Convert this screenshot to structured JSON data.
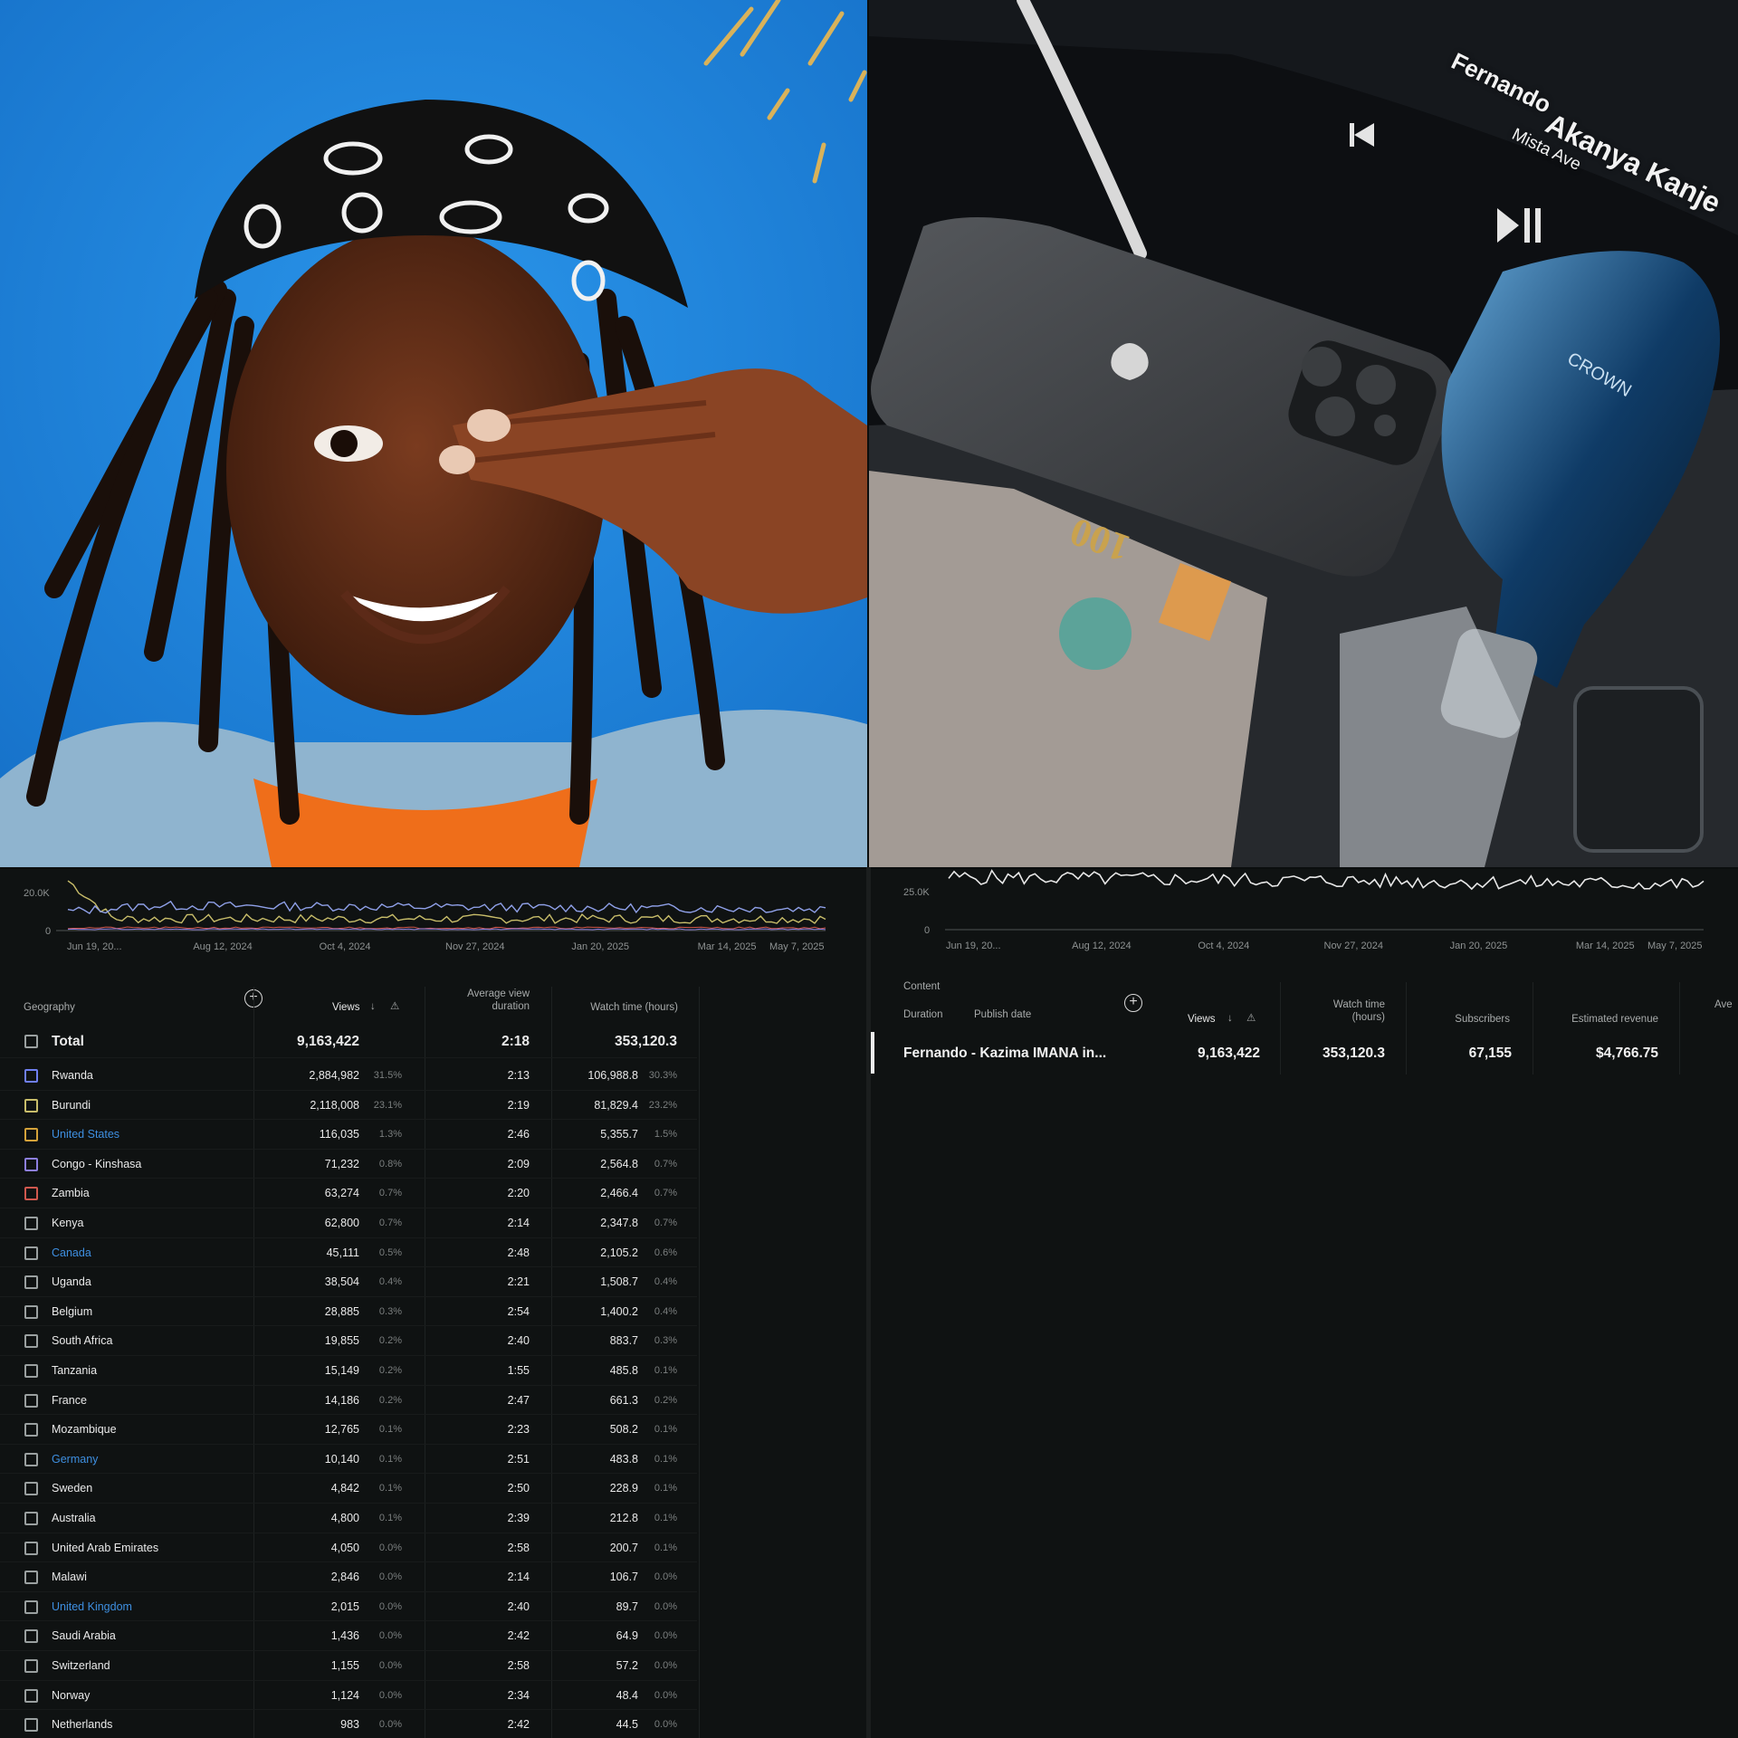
{
  "photo_right": {
    "track_artist": "Fernando",
    "track_title": "Akanya Kanje",
    "track_feat": "Mista Ave",
    "brand_text": "CROWN",
    "bill_text": "100"
  },
  "geo_chart": {
    "y_ticks": [
      "20.0K",
      "0"
    ],
    "x_ticks": [
      "Jun 19, 20...",
      "Aug 12, 2024",
      "Oct 4, 2024",
      "Nov 27, 2024",
      "Jan 20, 2025",
      "Mar 14, 2025",
      "May 7, 2025"
    ]
  },
  "content_chart": {
    "y_ticks": [
      "25.0K",
      "0"
    ],
    "x_ticks": [
      "Jun 19, 20...",
      "Aug 12, 2024",
      "Oct 4, 2024",
      "Nov 27, 2024",
      "Jan 20, 2025",
      "Mar 14, 2025",
      "May 7, 2025"
    ]
  },
  "geo_table": {
    "headers": {
      "geography": "Geography",
      "views": "Views",
      "avg_line1": "Average view",
      "avg_line2": "duration",
      "watch_time": "Watch time (hours)"
    },
    "total": {
      "label": "Total",
      "views": "9,163,422",
      "avg": "2:18",
      "watch": "353,120.3"
    },
    "rows": [
      {
        "name": "Rwanda",
        "views": "2,884,982",
        "vpct": "31.5%",
        "avg": "2:13",
        "watch": "106,988.8",
        "wpct": "30.3%",
        "color": "#6f7ff0",
        "link": false
      },
      {
        "name": "Burundi",
        "views": "2,118,008",
        "vpct": "23.1%",
        "avg": "2:19",
        "watch": "81,829.4",
        "wpct": "23.2%",
        "color": "#c8bd6a",
        "link": false
      },
      {
        "name": "United States",
        "views": "116,035",
        "vpct": "1.3%",
        "avg": "2:46",
        "watch": "5,355.7",
        "wpct": "1.5%",
        "color": "#d4a23a",
        "link": true
      },
      {
        "name": "Congo - Kinshasa",
        "views": "71,232",
        "vpct": "0.8%",
        "avg": "2:09",
        "watch": "2,564.8",
        "wpct": "0.7%",
        "color": "#8d7fe0",
        "link": false
      },
      {
        "name": "Zambia",
        "views": "63,274",
        "vpct": "0.7%",
        "avg": "2:20",
        "watch": "2,466.4",
        "wpct": "0.7%",
        "color": "#d0584e",
        "link": false
      },
      {
        "name": "Kenya",
        "views": "62,800",
        "vpct": "0.7%",
        "avg": "2:14",
        "watch": "2,347.8",
        "wpct": "0.7%",
        "color": "#9aa0a0",
        "link": false
      },
      {
        "name": "Canada",
        "views": "45,111",
        "vpct": "0.5%",
        "avg": "2:48",
        "watch": "2,105.2",
        "wpct": "0.6%",
        "color": "#9aa0a0",
        "link": true
      },
      {
        "name": "Uganda",
        "views": "38,504",
        "vpct": "0.4%",
        "avg": "2:21",
        "watch": "1,508.7",
        "wpct": "0.4%",
        "color": "#9aa0a0",
        "link": false
      },
      {
        "name": "Belgium",
        "views": "28,885",
        "vpct": "0.3%",
        "avg": "2:54",
        "watch": "1,400.2",
        "wpct": "0.4%",
        "color": "#9aa0a0",
        "link": false
      },
      {
        "name": "South Africa",
        "views": "19,855",
        "vpct": "0.2%",
        "avg": "2:40",
        "watch": "883.7",
        "wpct": "0.3%",
        "color": "#9aa0a0",
        "link": false
      },
      {
        "name": "Tanzania",
        "views": "15,149",
        "vpct": "0.2%",
        "avg": "1:55",
        "watch": "485.8",
        "wpct": "0.1%",
        "color": "#9aa0a0",
        "link": false
      },
      {
        "name": "France",
        "views": "14,186",
        "vpct": "0.2%",
        "avg": "2:47",
        "watch": "661.3",
        "wpct": "0.2%",
        "color": "#9aa0a0",
        "link": false
      },
      {
        "name": "Mozambique",
        "views": "12,765",
        "vpct": "0.1%",
        "avg": "2:23",
        "watch": "508.2",
        "wpct": "0.1%",
        "color": "#9aa0a0",
        "link": false
      },
      {
        "name": "Germany",
        "views": "10,140",
        "vpct": "0.1%",
        "avg": "2:51",
        "watch": "483.8",
        "wpct": "0.1%",
        "color": "#9aa0a0",
        "link": true
      },
      {
        "name": "Sweden",
        "views": "4,842",
        "vpct": "0.1%",
        "avg": "2:50",
        "watch": "228.9",
        "wpct": "0.1%",
        "color": "#9aa0a0",
        "link": false
      },
      {
        "name": "Australia",
        "views": "4,800",
        "vpct": "0.1%",
        "avg": "2:39",
        "watch": "212.8",
        "wpct": "0.1%",
        "color": "#9aa0a0",
        "link": false
      },
      {
        "name": "United Arab Emirates",
        "views": "4,050",
        "vpct": "0.0%",
        "avg": "2:58",
        "watch": "200.7",
        "wpct": "0.1%",
        "color": "#9aa0a0",
        "link": false
      },
      {
        "name": "Malawi",
        "views": "2,846",
        "vpct": "0.0%",
        "avg": "2:14",
        "watch": "106.7",
        "wpct": "0.0%",
        "color": "#9aa0a0",
        "link": false
      },
      {
        "name": "United Kingdom",
        "views": "2,015",
        "vpct": "0.0%",
        "avg": "2:40",
        "watch": "89.7",
        "wpct": "0.0%",
        "color": "#9aa0a0",
        "link": true
      },
      {
        "name": "Saudi Arabia",
        "views": "1,436",
        "vpct": "0.0%",
        "avg": "2:42",
        "watch": "64.9",
        "wpct": "0.0%",
        "color": "#9aa0a0",
        "link": false
      },
      {
        "name": "Switzerland",
        "views": "1,155",
        "vpct": "0.0%",
        "avg": "2:58",
        "watch": "57.2",
        "wpct": "0.0%",
        "color": "#9aa0a0",
        "link": false
      },
      {
        "name": "Norway",
        "views": "1,124",
        "vpct": "0.0%",
        "avg": "2:34",
        "watch": "48.4",
        "wpct": "0.0%",
        "color": "#9aa0a0",
        "link": false
      },
      {
        "name": "Netherlands",
        "views": "983",
        "vpct": "0.0%",
        "avg": "2:42",
        "watch": "44.5",
        "wpct": "0.0%",
        "color": "#9aa0a0",
        "link": false
      }
    ]
  },
  "content_table": {
    "headers": {
      "content": "Content",
      "duration": "Duration",
      "publish_date": "Publish date",
      "views": "Views",
      "watch_line1": "Watch time",
      "watch_line2": "(hours)",
      "subscribers": "Subscribers",
      "revenue": "Estimated revenue",
      "avg_cut": "Ave"
    },
    "row": {
      "title": "Fernando - Kazima IMANA in...",
      "views": "9,163,422",
      "watch": "353,120.3",
      "subscribers": "67,155",
      "revenue": "$4,766.75"
    }
  },
  "colors": {
    "background": "#0f1212",
    "photo_bg_blue": "#1f86e0",
    "link_blue": "#3e8fe0"
  }
}
